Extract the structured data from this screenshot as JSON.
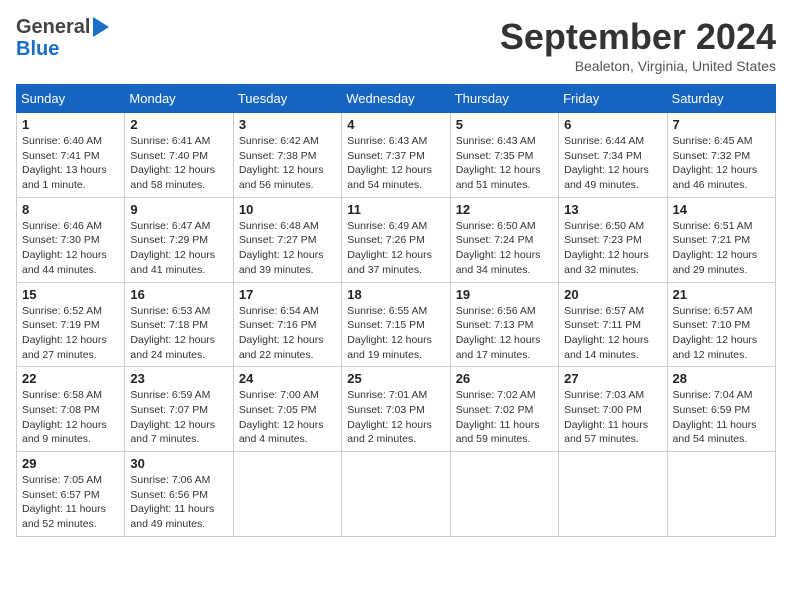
{
  "header": {
    "logo_general": "General",
    "logo_blue": "Blue",
    "month_title": "September 2024",
    "location": "Bealeton, Virginia, United States"
  },
  "weekdays": [
    "Sunday",
    "Monday",
    "Tuesday",
    "Wednesday",
    "Thursday",
    "Friday",
    "Saturday"
  ],
  "weeks": [
    [
      {
        "day": "1",
        "info": "Sunrise: 6:40 AM\nSunset: 7:41 PM\nDaylight: 13 hours\nand 1 minute."
      },
      {
        "day": "2",
        "info": "Sunrise: 6:41 AM\nSunset: 7:40 PM\nDaylight: 12 hours\nand 58 minutes."
      },
      {
        "day": "3",
        "info": "Sunrise: 6:42 AM\nSunset: 7:38 PM\nDaylight: 12 hours\nand 56 minutes."
      },
      {
        "day": "4",
        "info": "Sunrise: 6:43 AM\nSunset: 7:37 PM\nDaylight: 12 hours\nand 54 minutes."
      },
      {
        "day": "5",
        "info": "Sunrise: 6:43 AM\nSunset: 7:35 PM\nDaylight: 12 hours\nand 51 minutes."
      },
      {
        "day": "6",
        "info": "Sunrise: 6:44 AM\nSunset: 7:34 PM\nDaylight: 12 hours\nand 49 minutes."
      },
      {
        "day": "7",
        "info": "Sunrise: 6:45 AM\nSunset: 7:32 PM\nDaylight: 12 hours\nand 46 minutes."
      }
    ],
    [
      {
        "day": "8",
        "info": "Sunrise: 6:46 AM\nSunset: 7:30 PM\nDaylight: 12 hours\nand 44 minutes."
      },
      {
        "day": "9",
        "info": "Sunrise: 6:47 AM\nSunset: 7:29 PM\nDaylight: 12 hours\nand 41 minutes."
      },
      {
        "day": "10",
        "info": "Sunrise: 6:48 AM\nSunset: 7:27 PM\nDaylight: 12 hours\nand 39 minutes."
      },
      {
        "day": "11",
        "info": "Sunrise: 6:49 AM\nSunset: 7:26 PM\nDaylight: 12 hours\nand 37 minutes."
      },
      {
        "day": "12",
        "info": "Sunrise: 6:50 AM\nSunset: 7:24 PM\nDaylight: 12 hours\nand 34 minutes."
      },
      {
        "day": "13",
        "info": "Sunrise: 6:50 AM\nSunset: 7:23 PM\nDaylight: 12 hours\nand 32 minutes."
      },
      {
        "day": "14",
        "info": "Sunrise: 6:51 AM\nSunset: 7:21 PM\nDaylight: 12 hours\nand 29 minutes."
      }
    ],
    [
      {
        "day": "15",
        "info": "Sunrise: 6:52 AM\nSunset: 7:19 PM\nDaylight: 12 hours\nand 27 minutes."
      },
      {
        "day": "16",
        "info": "Sunrise: 6:53 AM\nSunset: 7:18 PM\nDaylight: 12 hours\nand 24 minutes."
      },
      {
        "day": "17",
        "info": "Sunrise: 6:54 AM\nSunset: 7:16 PM\nDaylight: 12 hours\nand 22 minutes."
      },
      {
        "day": "18",
        "info": "Sunrise: 6:55 AM\nSunset: 7:15 PM\nDaylight: 12 hours\nand 19 minutes."
      },
      {
        "day": "19",
        "info": "Sunrise: 6:56 AM\nSunset: 7:13 PM\nDaylight: 12 hours\nand 17 minutes."
      },
      {
        "day": "20",
        "info": "Sunrise: 6:57 AM\nSunset: 7:11 PM\nDaylight: 12 hours\nand 14 minutes."
      },
      {
        "day": "21",
        "info": "Sunrise: 6:57 AM\nSunset: 7:10 PM\nDaylight: 12 hours\nand 12 minutes."
      }
    ],
    [
      {
        "day": "22",
        "info": "Sunrise: 6:58 AM\nSunset: 7:08 PM\nDaylight: 12 hours\nand 9 minutes."
      },
      {
        "day": "23",
        "info": "Sunrise: 6:59 AM\nSunset: 7:07 PM\nDaylight: 12 hours\nand 7 minutes."
      },
      {
        "day": "24",
        "info": "Sunrise: 7:00 AM\nSunset: 7:05 PM\nDaylight: 12 hours\nand 4 minutes."
      },
      {
        "day": "25",
        "info": "Sunrise: 7:01 AM\nSunset: 7:03 PM\nDaylight: 12 hours\nand 2 minutes."
      },
      {
        "day": "26",
        "info": "Sunrise: 7:02 AM\nSunset: 7:02 PM\nDaylight: 11 hours\nand 59 minutes."
      },
      {
        "day": "27",
        "info": "Sunrise: 7:03 AM\nSunset: 7:00 PM\nDaylight: 11 hours\nand 57 minutes."
      },
      {
        "day": "28",
        "info": "Sunrise: 7:04 AM\nSunset: 6:59 PM\nDaylight: 11 hours\nand 54 minutes."
      }
    ],
    [
      {
        "day": "29",
        "info": "Sunrise: 7:05 AM\nSunset: 6:57 PM\nDaylight: 11 hours\nand 52 minutes."
      },
      {
        "day": "30",
        "info": "Sunrise: 7:06 AM\nSunset: 6:56 PM\nDaylight: 11 hours\nand 49 minutes."
      },
      null,
      null,
      null,
      null,
      null
    ]
  ]
}
